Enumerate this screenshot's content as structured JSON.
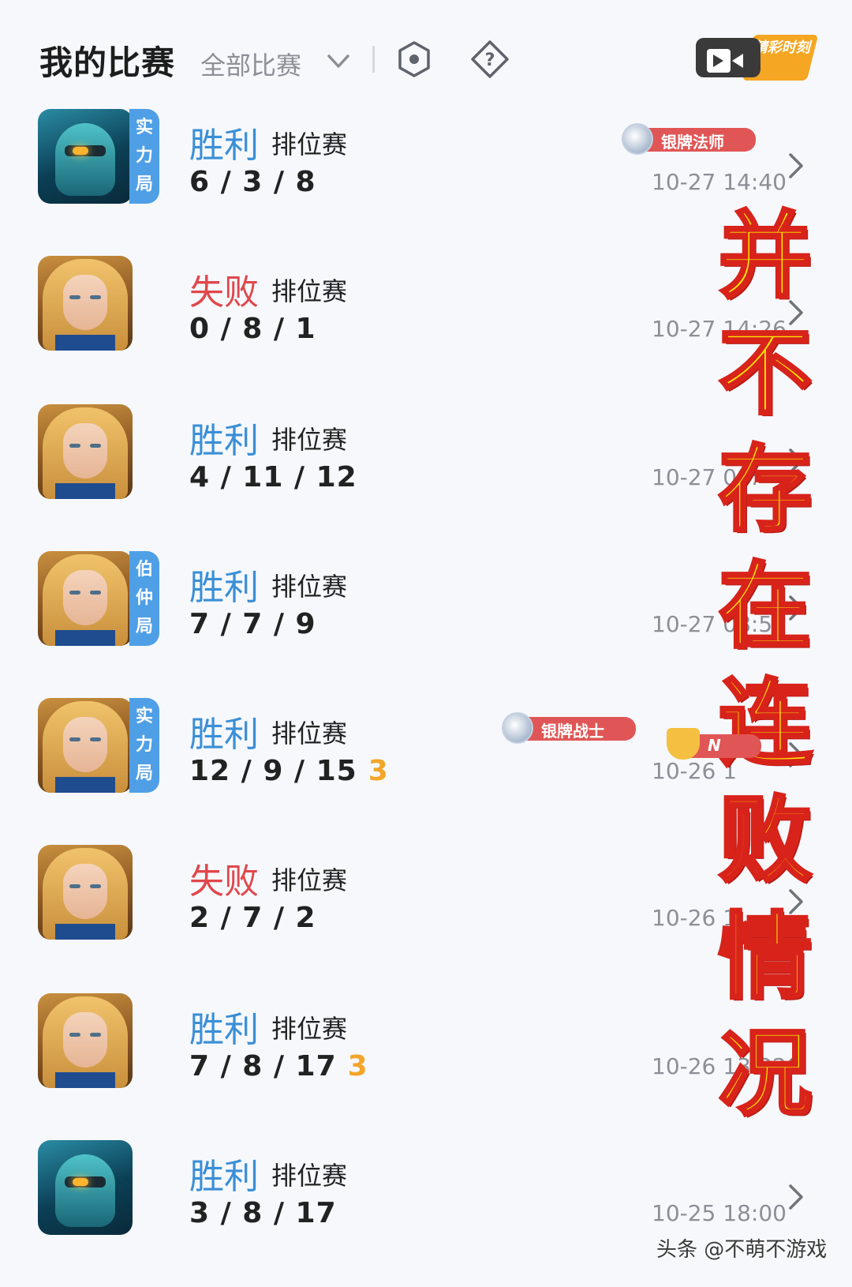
{
  "header": {
    "title": "我的比赛",
    "filter_label": "全部比赛",
    "video_label": "精彩时刻",
    "icons": [
      "chevron-down-icon",
      "hexagon-settings-icon",
      "help-icon",
      "video-camera-icon"
    ]
  },
  "matches": [
    {
      "avatar": "mech",
      "tag": "实力局",
      "result": "胜利",
      "result_type": "win",
      "mode": "排位赛",
      "kda": "6 / 3 / 8",
      "mvp": "",
      "time": "10-27 14:40",
      "badge": "银牌法师"
    },
    {
      "avatar": "girl",
      "tag": "",
      "result": "失败",
      "result_type": "lose",
      "mode": "排位赛",
      "kda": "0 / 8 / 1",
      "mvp": "",
      "time": "10-27 14:26",
      "badge": ""
    },
    {
      "avatar": "girl",
      "tag": "",
      "result": "胜利",
      "result_type": "win",
      "mode": "排位赛",
      "kda": "4 / 11 / 12",
      "mvp": "",
      "time": "10-27 09:",
      "badge": ""
    },
    {
      "avatar": "girl",
      "tag": "伯仲局",
      "result": "胜利",
      "result_type": "win",
      "mode": "排位赛",
      "kda": "7 / 7 / 9",
      "mvp": "",
      "time": "10-27 08:59",
      "badge": ""
    },
    {
      "avatar": "girl",
      "tag": "实力局",
      "result": "胜利",
      "result_type": "win",
      "mode": "排位赛",
      "kda": "12 / 9 / 15",
      "mvp": "3",
      "time": "10-26 1",
      "badge": "银牌战士"
    },
    {
      "avatar": "girl",
      "tag": "",
      "result": "失败",
      "result_type": "lose",
      "mode": "排位赛",
      "kda": "2 / 7 / 2",
      "mvp": "",
      "time": "10-26 1",
      "badge": ""
    },
    {
      "avatar": "girl",
      "tag": "",
      "result": "胜利",
      "result_type": "win",
      "mode": "排位赛",
      "kda": "7 / 8 / 17",
      "mvp": "3",
      "time": "10-26 13:22",
      "badge": ""
    },
    {
      "avatar": "mech",
      "tag": "",
      "result": "胜利",
      "result_type": "win",
      "mode": "排位赛",
      "kda": "3 / 8 / 17",
      "mvp": "",
      "time": "10-25 18:00",
      "badge": ""
    }
  ],
  "trophy_label": "N",
  "overlay_caption": [
    "并",
    "不",
    "存",
    "在",
    "连",
    "败",
    "情",
    "况"
  ],
  "watermark": "头条 @不萌不游戏",
  "colors": {
    "win": "#3a8fd6",
    "lose": "#e0474c",
    "tag": "#4f9fe6",
    "badge": "#e05656",
    "mvp": "#f2a62a",
    "overlay_fill": "#ffe600",
    "overlay_stroke": "#d8231b"
  }
}
